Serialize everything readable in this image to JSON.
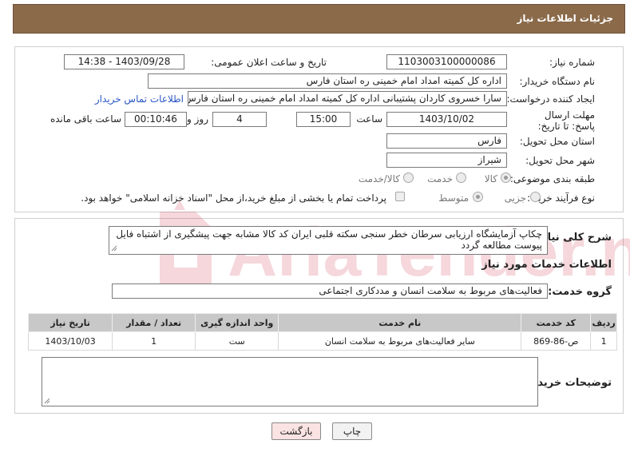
{
  "header": {
    "title": "جزئیات اطلاعات نیاز"
  },
  "fields": {
    "need_number_label": "شماره نیاز:",
    "need_number": "1103003100000086",
    "announce_label": "تاریخ و ساعت اعلان عمومی:",
    "announce_value": "1403/09/28 - 14:38",
    "buyer_org_label": "نام دستگاه خریدار:",
    "buyer_org": "اداره کل کمیته امداد امام خمینی  ره  استان فارس",
    "creator_label": "ایجاد کننده درخواست:",
    "creator": "سارا خسروی کاردان پشتیبانی  اداره کل کمیته امداد امام خمینی  ره  استان فارس",
    "contact_link": "اطلاعات تماس خریدار",
    "deadline_label": "مهلت ارسال پاسخ: تا تاریخ:",
    "deadline_date": "1403/10/02",
    "time_label": "ساعت",
    "deadline_time": "15:00",
    "days_value": "4",
    "days_label": "روز و",
    "remaining_time": "00:10:46",
    "remaining_label": "ساعت باقی مانده",
    "province_label": "استان محل تحویل:",
    "province": "فارس",
    "city_label": "شهر محل تحویل:",
    "city": "شیراز",
    "category_label": "طبقه بندی موضوعی:",
    "category_options": [
      "کالا",
      "خدمت",
      "کالا/خدمت"
    ],
    "process_label": "نوع فرآیند خرید :",
    "process_options": [
      "جزیی",
      "متوسط"
    ],
    "payment_note": "پرداخت تمام یا بخشی از مبلغ خرید،از محل \"اسناد خزانه اسلامی\" خواهد بود."
  },
  "summary": {
    "label": "شرح کلی نیاز:",
    "text": "چکاپ آزمایشگاه ارزیابی سرطان خطر سنجی سکته قلبی ایران کد کالا مشابه جهت پیشگیری از اشتباه فایل پیوست مطالعه گردد",
    "services_title": "اطلاعات خدمات مورد نیاز",
    "service_group_label": "گروه خدمت:",
    "service_group": "فعالیت‌های مربوط به سلامت انسان و مددکاری اجتماعی"
  },
  "table": {
    "headers": [
      "ردیف",
      "کد خدمت",
      "نام خدمت",
      "واحد اندازه گیری",
      "تعداد / مقدار",
      "تاریخ نیاز"
    ],
    "rows": [
      [
        "1",
        "ص-86-869",
        "سایر فعالیت‌های مربوط به سلامت انسان",
        "ست",
        "1",
        "1403/10/03"
      ]
    ]
  },
  "buyer_notes": {
    "label": "توضیحات خریدار:",
    "value": ""
  },
  "buttons": {
    "print": "چاپ",
    "back": "بازگشت"
  },
  "watermark": {
    "text": "AriaTender.net"
  },
  "colors": {
    "header": "#8b6a4a",
    "link": "#2a57c6",
    "watermark": "#c8102e"
  }
}
